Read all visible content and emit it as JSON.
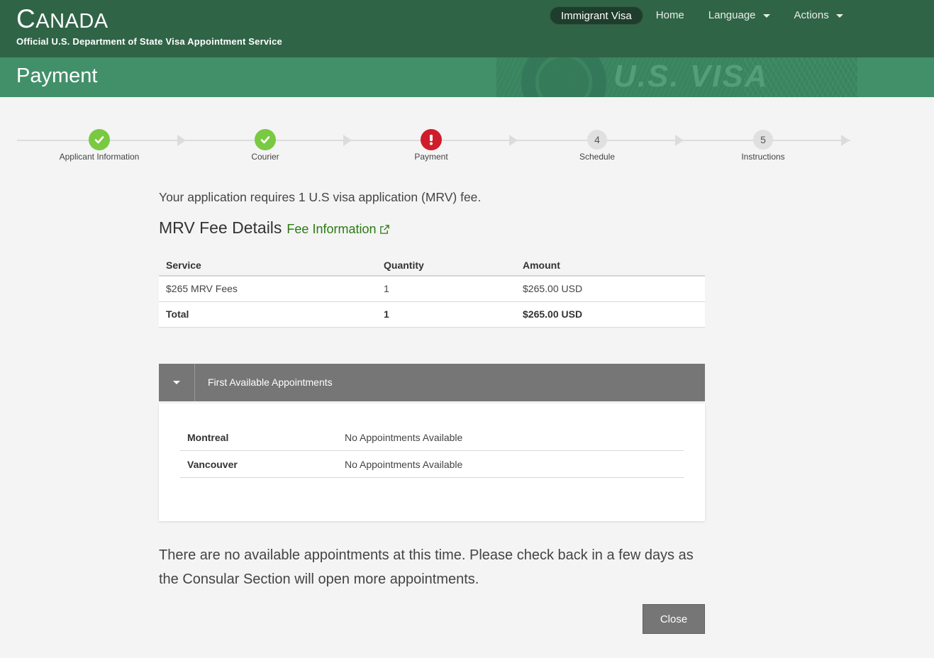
{
  "header": {
    "title_first": "C",
    "title_rest": "ANADA",
    "subtitle": "Official U.S. Department of State Visa Appointment Service",
    "nav": {
      "immigrant_visa": "Immigrant Visa",
      "home": "Home",
      "language": "Language",
      "actions": "Actions"
    }
  },
  "page": {
    "title": "Payment",
    "banner_text": "U.S. VISA"
  },
  "steps": [
    {
      "label": "Applicant Information",
      "state": "done"
    },
    {
      "label": "Courier",
      "state": "done"
    },
    {
      "label": "Payment",
      "state": "error"
    },
    {
      "label": "Schedule",
      "state": "pending",
      "number": "4"
    },
    {
      "label": "Instructions",
      "state": "pending",
      "number": "5"
    }
  ],
  "content": {
    "intro": "Your application requires 1 U.S visa application (MRV) fee.",
    "fee_heading": "MRV Fee Details",
    "fee_link": "Fee Information",
    "fee_table": {
      "headers": [
        "Service",
        "Quantity",
        "Amount"
      ],
      "rows": [
        {
          "service": "$265 MRV Fees",
          "quantity": "1",
          "amount": "$265.00 USD"
        }
      ],
      "total": {
        "service": "Total",
        "quantity": "1",
        "amount": "$265.00 USD"
      }
    },
    "appointments": {
      "title": "First Available Appointments",
      "rows": [
        {
          "city": "Montreal",
          "status": "No Appointments Available"
        },
        {
          "city": "Vancouver",
          "status": "No Appointments Available"
        }
      ]
    },
    "notice": "There are no available appointments at this time. Please check back in a few days as the Consular Section will open more appointments.",
    "close_label": "Close"
  },
  "colors": {
    "header_bg": "#306447",
    "title_band_bg": "#42906a",
    "step_done": "#7ac943",
    "step_error": "#d01d2b",
    "link_green": "#2b7a13",
    "panel_header": "#767676"
  }
}
